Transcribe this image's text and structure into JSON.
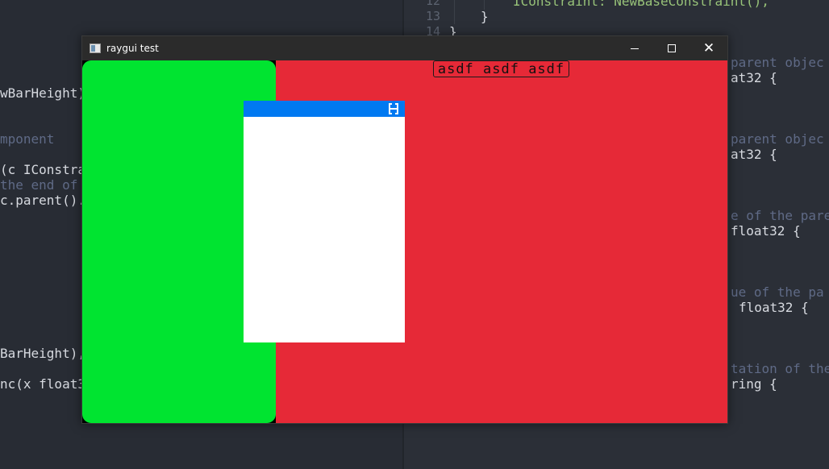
{
  "editor": {
    "left_lines": [
      {
        "text": "wBarHeight)",
        "color": "#d7dae0"
      },
      {
        "text": "mponent",
        "color": "#5f6a86"
      },
      {
        "text": "(c IConstra",
        "color": "#d7dae0"
      },
      {
        "text": "the end of",
        "color": "#5f6a86"
      },
      {
        "text": "c.parent().",
        "color": "#d7dae0"
      },
      {
        "text": "BarHeight),",
        "color": "#d7dae0"
      },
      {
        "text": "nc(x float3",
        "color": "#d7dae0"
      }
    ],
    "right_line_numbers": [
      "12",
      "13",
      "14"
    ],
    "right_top_lines": [
      "IConstraint: NewBaseConstraint(),",
      "}",
      "}"
    ],
    "right_lines": [
      "parent objec",
      "at32 {",
      "parent objec",
      "at32 {",
      "e of the pare",
      "float32 {",
      "ue of the pa",
      "float32 {",
      "tation of the",
      "ring {"
    ]
  },
  "window": {
    "title": "raygui test",
    "controls": {
      "minimize": "minimize-icon",
      "maximize": "maximize-icon",
      "close": "close-icon"
    },
    "label": "asdf asdf asdf",
    "colors": {
      "left_panel": "#00e430",
      "right_panel": "#e62937",
      "popup_header": "#0079f1",
      "popup_body": "#ffffff"
    },
    "popup_header_icon": "resize-icon"
  }
}
